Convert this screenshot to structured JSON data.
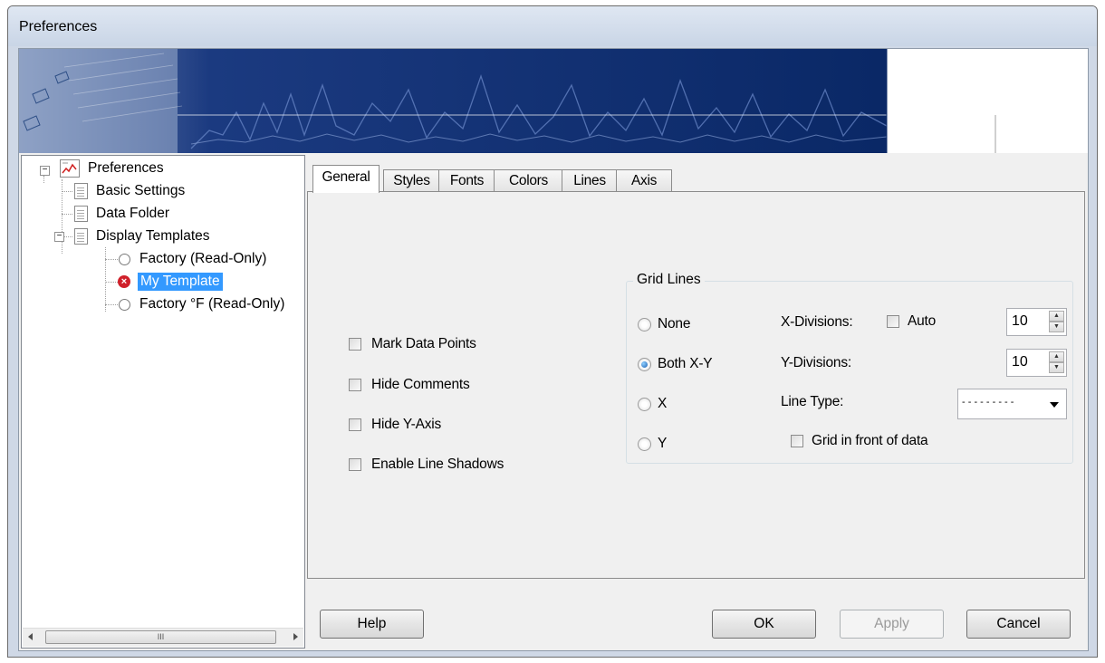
{
  "window": {
    "title": "Preferences"
  },
  "tree": {
    "root": "Preferences",
    "items": [
      {
        "label": "Basic Settings"
      },
      {
        "label": "Data Folder"
      },
      {
        "label": "Display Templates"
      },
      {
        "label": "Factory (Read-Only)"
      },
      {
        "label": "My Template"
      },
      {
        "label": "Factory °F (Read-Only)"
      }
    ],
    "selected": "My Template",
    "scroll_grip": "III"
  },
  "tabs": [
    "General",
    "Styles",
    "Fonts",
    "Colors",
    "Lines",
    "Axis"
  ],
  "active_tab": "General",
  "general": {
    "checkboxes": [
      {
        "label": "Mark Data Points",
        "checked": false
      },
      {
        "label": "Hide Comments",
        "checked": false
      },
      {
        "label": "Hide Y-Axis",
        "checked": false
      },
      {
        "label": "Enable Line Shadows",
        "checked": false
      }
    ],
    "grid": {
      "title": "Grid Lines",
      "options": [
        "None",
        "Both X-Y",
        "X",
        "Y"
      ],
      "selected": "Both X-Y",
      "x_label": "X-Divisions:",
      "auto_label": "Auto",
      "auto_checked": false,
      "x_value": "10",
      "y_label": "Y-Divisions:",
      "y_value": "10",
      "linetype_label": "Line Type:",
      "linetype_value": "- - - - - - - - -",
      "front_label": "Grid in front of data",
      "front_checked": false
    }
  },
  "buttons": {
    "help": "Help",
    "ok": "OK",
    "apply": "Apply",
    "cancel": "Cancel",
    "apply_enabled": false
  },
  "colors": {
    "banner_blue": "#0f2d6b",
    "selection": "#3399ff",
    "error_icon": "#d0202a"
  }
}
